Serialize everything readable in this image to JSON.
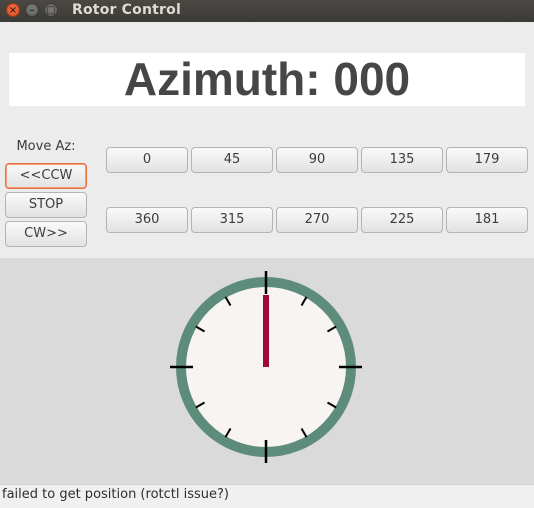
{
  "window": {
    "title": "Rotor Control"
  },
  "display": {
    "azimuth_text": "Azimuth: 000"
  },
  "controls": {
    "move_label": "Move Az:",
    "ccw_label": "<<CCW",
    "stop_label": "STOP",
    "cw_label": "CW>>"
  },
  "presets": {
    "row1": [
      "0",
      "45",
      "90",
      "135",
      "179"
    ],
    "row2": [
      "360",
      "315",
      "270",
      "225",
      "181"
    ]
  },
  "dial": {
    "azimuth_deg": 0,
    "ring_color": "#5e8c7c",
    "face_color": "#f7f4f2",
    "needle_color": "#9e0a3a",
    "tick_color": "#000000"
  },
  "status": {
    "text": "failed to get position (rotctl issue?)"
  }
}
